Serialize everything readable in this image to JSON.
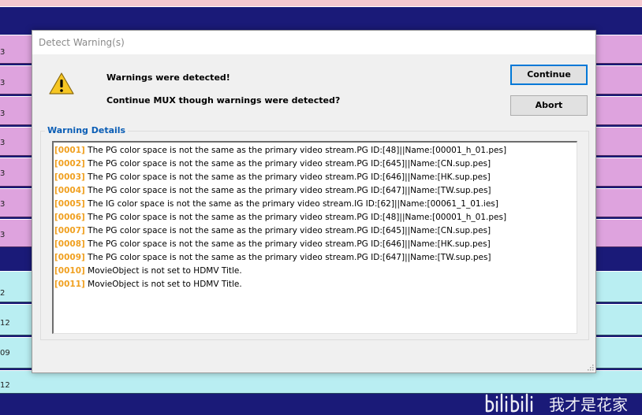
{
  "background": {
    "pink_row_numbers": [
      "3",
      "3",
      "3",
      "3",
      "3",
      "3",
      "3"
    ],
    "cyan_row_numbers": [
      "2",
      "12",
      "09",
      "12"
    ],
    "colors": {
      "navy": "#1a1a78",
      "pink": "#dea3de",
      "cyan": "#b9eef2",
      "top_strip": "#f5c8cf"
    }
  },
  "dialog": {
    "title": "Detect Warning(s)",
    "icon": "warning-triangle-icon",
    "message_1": "Warnings were detected!",
    "message_2": "Continue MUX though warnings were detected?",
    "continue_label": "Continue",
    "abort_label": "Abort",
    "group_label": "Warning Details",
    "warnings": [
      {
        "code": "[0001]",
        "text": "The PG color space is not the same as the primary video stream.PG ID:[48]||Name:[00001_h_01.pes]"
      },
      {
        "code": "[0002]",
        "text": "The PG color space is not the same as the primary video stream.PG ID:[645]||Name:[CN.sup.pes]"
      },
      {
        "code": "[0003]",
        "text": "The PG color space is not the same as the primary video stream.PG ID:[646]||Name:[HK.sup.pes]"
      },
      {
        "code": "[0004]",
        "text": "The PG color space is not the same as the primary video stream.PG ID:[647]||Name:[TW.sup.pes]"
      },
      {
        "code": "[0005]",
        "text": "The IG color space is not the same as the primary video stream.IG ID:[62]||Name:[00061_1_01.ies]"
      },
      {
        "code": "[0006]",
        "text": "The PG color space is not the same as the primary video stream.PG ID:[48]||Name:[00001_h_01.pes]"
      },
      {
        "code": "[0007]",
        "text": "The PG color space is not the same as the primary video stream.PG ID:[645]||Name:[CN.sup.pes]"
      },
      {
        "code": "[0008]",
        "text": "The PG color space is not the same as the primary video stream.PG ID:[646]||Name:[HK.sup.pes]"
      },
      {
        "code": "[0009]",
        "text": "The PG color space is not the same as the primary video stream.PG ID:[647]||Name:[TW.sup.pes]"
      },
      {
        "code": "[0010]",
        "text": "MovieObject is not set to HDMV Title."
      },
      {
        "code": "[0011]",
        "text": "MovieObject is not set to HDMV Title."
      }
    ],
    "colors": {
      "code": "#f0a020",
      "group_label": "#0a5db5",
      "focus_border": "#0078d7"
    }
  },
  "watermark": {
    "logo": "bilibili-logo-icon",
    "text": "我才是花家"
  }
}
